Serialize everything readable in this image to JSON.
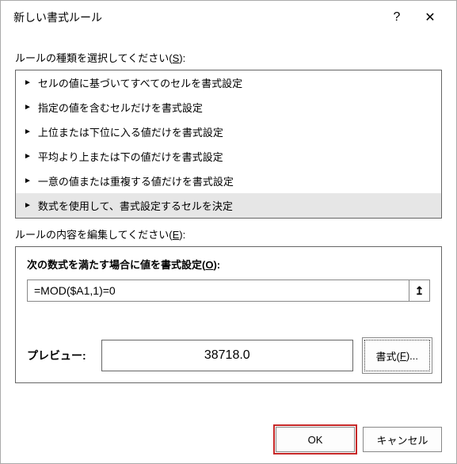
{
  "titlebar": {
    "title": "新しい書式ルール",
    "help": "?",
    "close": "✕"
  },
  "ruleTypeSection": {
    "label_pre": "ルールの種類を選択してください(",
    "label_key": "S",
    "label_post": "):",
    "items": [
      {
        "text": "セルの値に基づいてすべてのセルを書式設定",
        "selected": false
      },
      {
        "text": "指定の値を含むセルだけを書式設定",
        "selected": false
      },
      {
        "text": "上位または下位に入る値だけを書式設定",
        "selected": false
      },
      {
        "text": "平均より上または下の値だけを書式設定",
        "selected": false
      },
      {
        "text": "一意の値または重複する値だけを書式設定",
        "selected": false
      },
      {
        "text": "数式を使用して、書式設定するセルを決定",
        "selected": true
      }
    ]
  },
  "editSection": {
    "label_pre": "ルールの内容を編集してください(",
    "label_key": "E",
    "label_post": "):",
    "title_pre": "次の数式を満たす場合に値を書式設定(",
    "title_key": "O",
    "title_post": "):",
    "formula": "=MOD($A1,1)=0",
    "refBtn": "↥",
    "previewLabel": "プレビュー:",
    "previewValue": "38718.0",
    "formatBtn_pre": "書式(",
    "formatBtn_key": "F",
    "formatBtn_post": ")..."
  },
  "footer": {
    "ok": "OK",
    "cancel": "キャンセル"
  }
}
